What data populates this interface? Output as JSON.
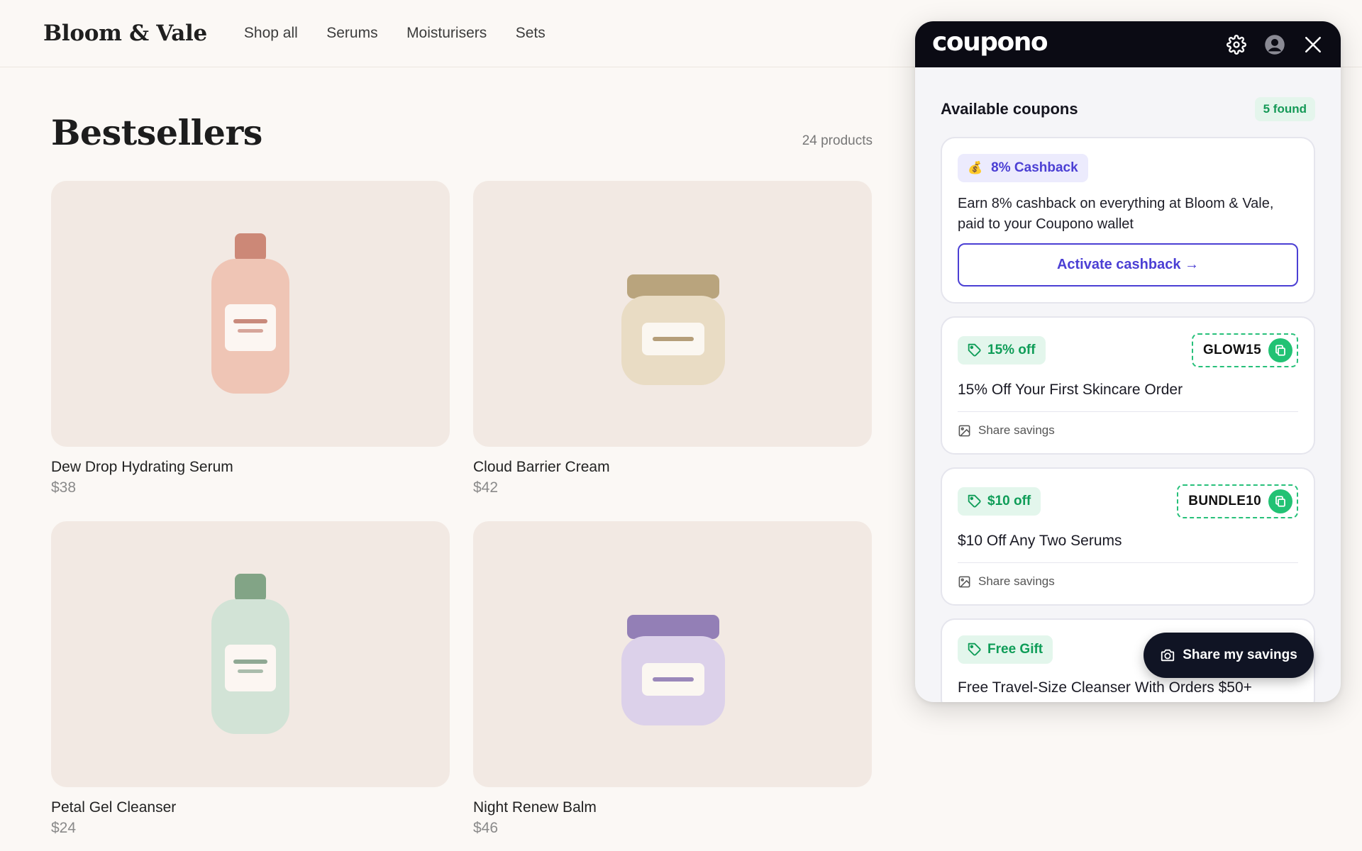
{
  "store": {
    "logo": "Bloom & Vale",
    "nav": [
      "Shop all",
      "Serums",
      "Moisturisers",
      "Sets"
    ],
    "page_title": "Bestsellers",
    "product_count": "24 products",
    "products": [
      {
        "name": "Dew Drop Hydrating Serum",
        "price": "$38",
        "icon": "serum-bottle-icon",
        "colors": {
          "cap": "#cc8877",
          "body": "#efc5b5",
          "line": "#c98a7c"
        }
      },
      {
        "name": "Cloud Barrier Cream",
        "price": "$42",
        "icon": "cream-jar-icon",
        "colors": {
          "lid": "#b9a47d",
          "body": "#e9dcc4",
          "line": "#b59e79"
        }
      },
      {
        "name": "Petal Gel Cleanser",
        "price": "$24",
        "icon": "cleanser-bottle-icon",
        "colors": {
          "cap": "#82a486",
          "body": "#d2e3d6",
          "line": "#8fa894"
        }
      },
      {
        "name": "Night Renew Balm",
        "price": "$46",
        "icon": "balm-jar-icon",
        "colors": {
          "lid": "#937fb6",
          "body": "#dcd1ea",
          "line": "#9a88ba"
        }
      }
    ]
  },
  "extension": {
    "brand": "coupono",
    "icons": {
      "settings": "gear-icon",
      "account": "user-icon",
      "close": "close-icon"
    },
    "section_title": "Available coupons",
    "found_badge": "5 found",
    "cashback": {
      "badge": "8% Cashback",
      "icon": "money-bag-icon",
      "description": "Earn 8% cashback on everything at Bloom & Vale, paid to your Coupono wallet",
      "button": "Activate cashback →"
    },
    "coupons": [
      {
        "discount": "15% off",
        "code": "GLOW15",
        "title": "15% Off Your First Skincare Order",
        "share": "Share savings"
      },
      {
        "discount": "$10 off",
        "code": "BUNDLE10",
        "title": "$10 Off Any Two Serums",
        "share": "Share savings"
      },
      {
        "discount": "Free Gift",
        "code": "",
        "title": "Free Travel-Size Cleanser With Orders $50+",
        "share": ""
      }
    ],
    "fab_label": "Share my savings",
    "colors": {
      "accent_purple": "#4b3fd4",
      "accent_green": "#22c274",
      "header_dark": "#0b0b14"
    }
  }
}
